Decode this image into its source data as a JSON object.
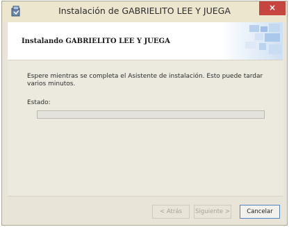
{
  "window": {
    "title": "Instalación de GABRIELITO LEE Y JUEGA",
    "close_label": "×"
  },
  "banner": {
    "heading": "Instalando GABRIELITO LEE Y JUEGA"
  },
  "content": {
    "description": "Espere mientras se completa el Asistente de instalación. Esto puede tardar varios minutos.",
    "status_label": "Estado:",
    "progress_fraction": 0
  },
  "buttons": {
    "back": "< Atrás",
    "next": "Siguiente >",
    "cancel": "Cancelar"
  },
  "colors": {
    "titlebar": "#ece6cf",
    "close": "#c7453f",
    "progress_fill": "#06b025"
  }
}
